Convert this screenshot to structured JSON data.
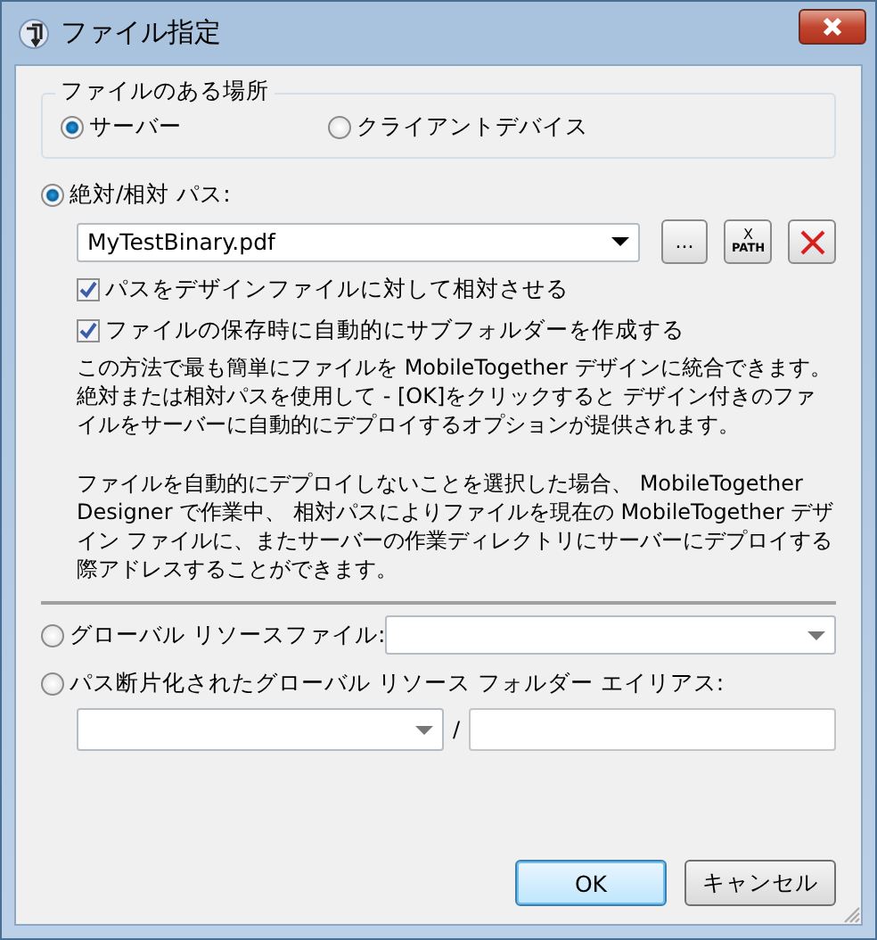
{
  "window": {
    "title": "ファイル指定"
  },
  "location": {
    "legend": "ファイルのある場所",
    "options": [
      {
        "label": "サーバー",
        "selected": true
      },
      {
        "label": "クライアントデバイス",
        "selected": false
      }
    ]
  },
  "sources": [
    {
      "kind": "path",
      "label": "絶対/相対 パス:",
      "selected": true,
      "value": "MyTestBinary.pdf",
      "tools": [
        {
          "kind": "browse",
          "label": "..."
        },
        {
          "kind": "xpath",
          "label": "X",
          "sublabel": "PATH"
        },
        {
          "kind": "clear"
        }
      ],
      "checkboxes": [
        {
          "label": "パスをデザインファイルに対して相対させる",
          "checked": true
        },
        {
          "label": "ファイルの保存時に自動的にサブフォルダーを作成する",
          "checked": true
        }
      ],
      "notes": [
        "この方法で最も簡単にファイルを MobileTogether デザインに統合できます。絶対または相対パスを使用して - [OK]をクリックすると デザイン付きのファイルをサーバーに自動的にデプロイするオプションが提供されます。",
        "ファイルを自動的にデプロイしないことを選択した場合、 MobileTogether Designer で作業中、 相対パスによりファイルを現在の MobileTogether デザイン ファイルに、またサーバーの作業ディレクトリにサーバーにデプロイする際アドレスすることができます。"
      ]
    },
    {
      "kind": "global_file",
      "label": "グローバル リソースファイル:",
      "selected": false
    },
    {
      "kind": "global_folder",
      "label": "パス断片化されたグローバル リソース フォルダー エイリアス:",
      "selected": false,
      "separator": "/"
    }
  ],
  "buttons": [
    {
      "label": "OK",
      "default": true
    },
    {
      "label": "キャンセル",
      "default": false
    }
  ]
}
